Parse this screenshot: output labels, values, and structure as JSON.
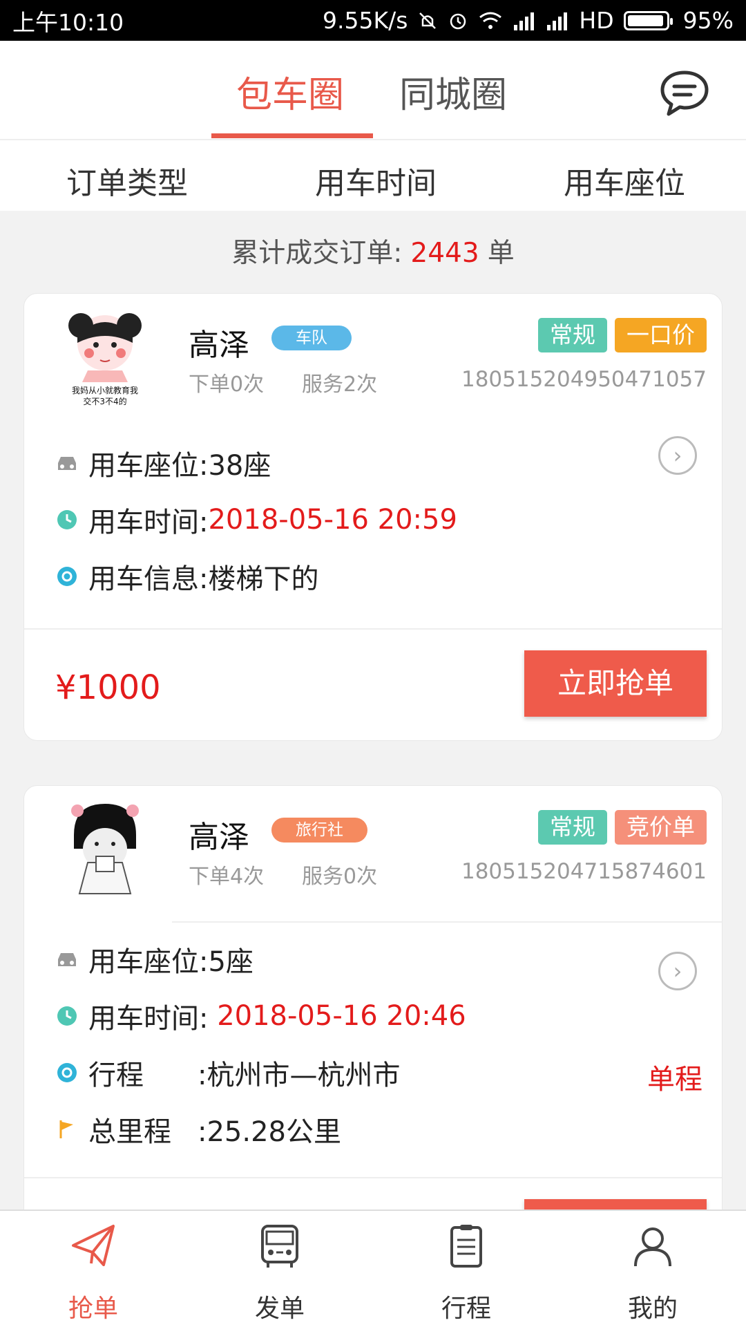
{
  "status_bar": {
    "time": "上午10:10",
    "speed": "9.55K/s",
    "network": "HD",
    "battery": "95%",
    "battery_level": 0.95
  },
  "top_tabs": [
    {
      "label": "包车圈",
      "active": true
    },
    {
      "label": "同城圈",
      "active": false
    }
  ],
  "header_icon": "message-bubble-icon",
  "filters": [
    "订单类型",
    "用车时间",
    "用车座位"
  ],
  "summary": {
    "prefix": "累计成交订单:",
    "count": "2443",
    "unit": "单"
  },
  "orders": [
    {
      "avatar_caption_line1": "我妈从小就教育我",
      "avatar_caption_line2": "交不3不4的",
      "name": "高泽",
      "org_tag": "车队",
      "org_tag_color": "#5bb8e8",
      "order_count": "下单0次",
      "service_count": "服务2次",
      "badge1": "常规",
      "badge1_color": "#5cc9b0",
      "badge2": "一口价",
      "badge2_color": "#f5a623",
      "order_no": "180515204950471057",
      "seat_label": "用车座位:",
      "seat_value": "38座",
      "time_label": "用车时间:",
      "time_value": "2018-05-16 20:59",
      "info_label": "用车信息:",
      "info_value": "楼梯下的",
      "price": "¥1000",
      "button": "立即抢单"
    },
    {
      "name": "高泽",
      "org_tag": "旅行社",
      "org_tag_color": "#f58a5f",
      "order_count": "下单4次",
      "service_count": "服务0次",
      "badge1": "常规",
      "badge1_color": "#5cc9b0",
      "badge2": "竞价单",
      "badge2_color": "#f5907a",
      "order_no": "180515204715874601",
      "seat_label": "用车座位:",
      "seat_value": "5座",
      "time_label": "用车时间:",
      "time_value": " 2018-05-16 20:46",
      "route_label": "行程",
      "route_value": ":杭州市—杭州市",
      "route_type": "单程",
      "distance_label": "总里程",
      "distance_value": ":25.28公里"
    }
  ],
  "bottom_nav": [
    {
      "label": "抢单",
      "icon": "paper-plane-icon",
      "active": true
    },
    {
      "label": "发单",
      "icon": "bus-icon",
      "active": false
    },
    {
      "label": "行程",
      "icon": "clipboard-icon",
      "active": false
    },
    {
      "label": "我的",
      "icon": "person-icon",
      "active": false
    }
  ],
  "colors": {
    "accent": "#e8594a",
    "price_red": "#e31b1b",
    "button": "#ef5b4b"
  }
}
